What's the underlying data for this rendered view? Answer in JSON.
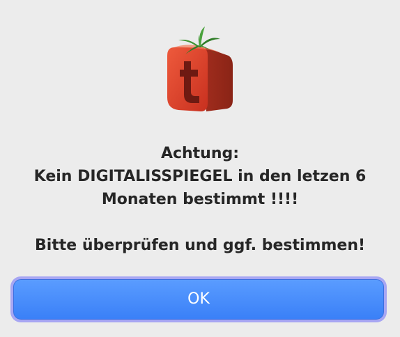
{
  "app_icon": {
    "icon": "tomato-t-logo-icon",
    "letter": "t",
    "colors": {
      "front_face": "#d23a2a",
      "side_face": "#9e2a1c",
      "letter": "#6e1a12",
      "stem": "#3a8a2f"
    }
  },
  "dialog": {
    "title": "Achtung:",
    "message_lines": [
      "Kein DIGITALISSPIEGEL in den letzen 6",
      "Monaten bestimmt !!!!"
    ],
    "instruction": "Bitte überprüfen und ggf. bestimmen!",
    "ok_label": "OK",
    "colors": {
      "button": "#3a80f7",
      "focus_ring": "#a7a6f3",
      "text": "#262626"
    }
  }
}
